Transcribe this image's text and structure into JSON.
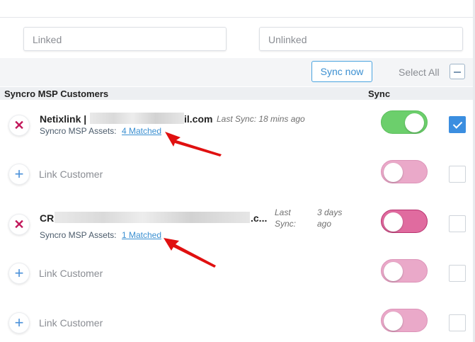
{
  "filters": {
    "linked_placeholder": "Linked",
    "unlinked_placeholder": "Unlinked"
  },
  "toolbar": {
    "sync_now_label": "Sync now",
    "select_all_label": "Select All"
  },
  "table": {
    "header_customers": "Syncro MSP Customers",
    "header_sync": "Sync"
  },
  "rows": [
    {
      "type": "linked",
      "name_prefix": "Netixlink |",
      "name_suffix": "il.com",
      "last_sync": "Last Sync: 18 mins ago",
      "assets_label": "Syncro MSP Assets:",
      "matched_label": "4 Matched",
      "sync_on": true,
      "selected": true
    },
    {
      "type": "unlinked",
      "link_label": "Link Customer",
      "sync_on": false,
      "selected": false
    },
    {
      "type": "linked",
      "name_prefix": "CR",
      "name_suffix": ".c...",
      "last_sync_label": "Last Sync:",
      "last_sync_value": "3 days ago",
      "assets_label": "Syncro MSP Assets:",
      "matched_label": "1 Matched",
      "sync_on": false,
      "selected": false
    },
    {
      "type": "unlinked",
      "link_label": "Link Customer",
      "sync_on": false,
      "selected": false
    },
    {
      "type": "unlinked",
      "link_label": "Link Customer",
      "sync_on": false,
      "selected": false
    }
  ],
  "colors": {
    "toggle_on": "#6ccf6c",
    "toggle_off": "#eaa9c9",
    "accent": "#3a8fd1",
    "unlink_icon": "#c2185b",
    "annotation_arrow": "#e01010"
  },
  "icons": {
    "unlink": "close-x-icon",
    "link": "plus-icon",
    "collapse": "minus-icon",
    "check": "checkmark-icon"
  }
}
